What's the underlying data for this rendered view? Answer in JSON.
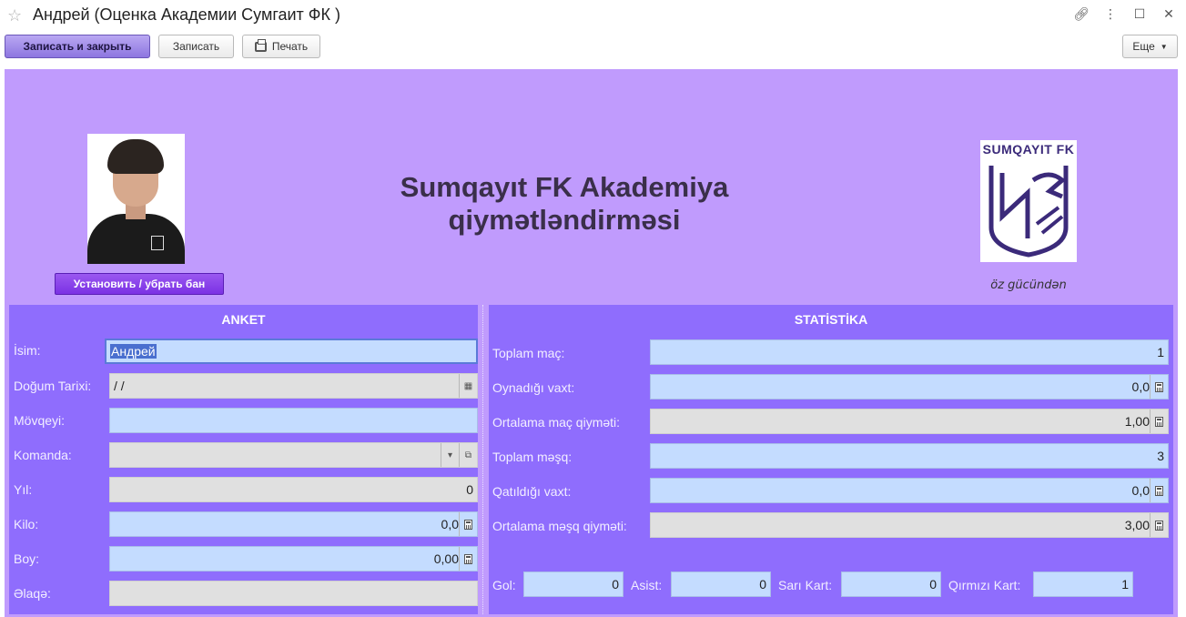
{
  "window": {
    "title": "Андрей (Оценка Академии  Сумгаит ФК )",
    "icons": [
      "star-icon",
      "link-icon",
      "more-vertical-icon",
      "maximize-icon",
      "close-icon"
    ]
  },
  "toolbar": {
    "save_close_label": "Записать и закрыть",
    "save_label": "Записать",
    "print_label": "Печать",
    "more_label": "Еще"
  },
  "header": {
    "ban_button_label": "Установить / убрать бан",
    "heading_line1": "Sumqayıt FK Akademiya",
    "heading_line2": "qiymətləndirməsi",
    "logo_text": "SUMQAYIT FK",
    "slogan": "öz gücündən"
  },
  "anket": {
    "title": "ANKET",
    "fields": {
      "name_label": "İsim:",
      "name_value": "Андрей",
      "dob_label": "Doğum Tarixi:",
      "dob_value": " /  /",
      "position_label": "Mövqeyi:",
      "position_value": "",
      "team_label": "Komanda:",
      "team_value": "",
      "year_label": "Yıl:",
      "year_value": "0",
      "weight_label": "Kilo:",
      "weight_value": "0,0",
      "height_label": "Boy:",
      "height_value": "0,00",
      "contact_label": "Əlaqə:",
      "contact_value": ""
    }
  },
  "statistika": {
    "title": "STATİSTİKA",
    "fields": {
      "total_matches_label": "Toplam maç:",
      "total_matches_value": "1",
      "played_time_label": "Oynadığı vaxt:",
      "played_time_value": "0,0",
      "avg_match_label": "Ortalama maç qiymәti:",
      "avg_match_value": "1,00",
      "total_training_label": "Toplam məşq:",
      "total_training_value": "3",
      "attended_time_label": "Qatıldığı vaxt:",
      "attended_time_value": "0,0",
      "avg_training_label": "Ortalama məşq qiymәti:",
      "avg_training_value": "3,00",
      "goals_label": "Gol:",
      "goals_value": "0",
      "assists_label": "Asist:",
      "assists_value": "0",
      "yellow_label": "Sarı Kart:",
      "yellow_value": "0",
      "red_label": "Qırmızı Kart:",
      "red_value": "1"
    }
  }
}
